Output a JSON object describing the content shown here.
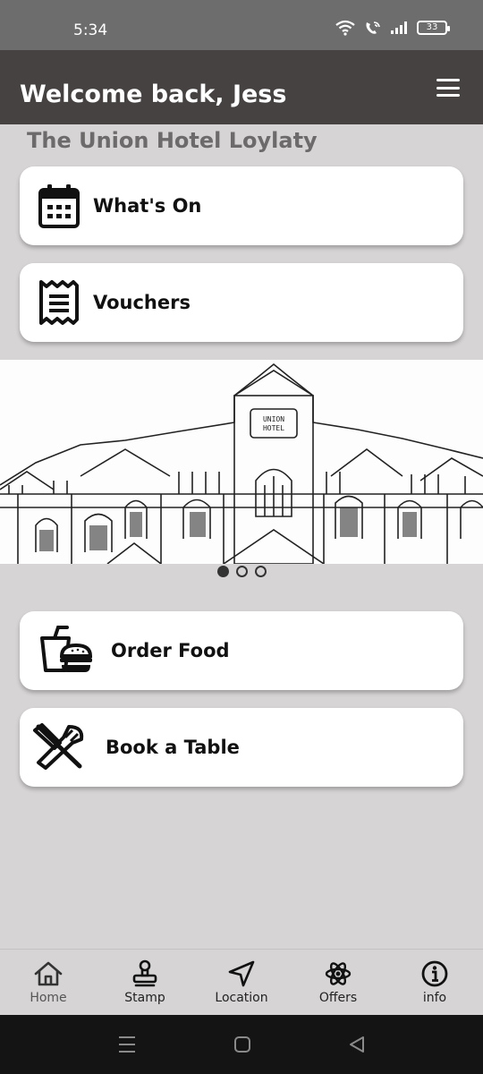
{
  "status_bar": {
    "time": "5:34",
    "battery": "33"
  },
  "header": {
    "title": "Welcome back, Jess",
    "menu_icon": "hamburger-menu-icon"
  },
  "subtitle": "The Union Hotel Loylaty",
  "cards_top": [
    {
      "label": "What's On",
      "icon": "calendar-icon"
    },
    {
      "label": "Vouchers",
      "icon": "receipt-icon"
    }
  ],
  "carousel": {
    "image": "union-hotel-sketch",
    "sign_text_line1": "UNION",
    "sign_text_line2": "HOTEL",
    "slide_count": 3,
    "active_index": 0
  },
  "cards_bottom": [
    {
      "label": "Order Food",
      "icon": "drink-burger-icon"
    },
    {
      "label": "Book a Table",
      "icon": "utensils-icon"
    }
  ],
  "bottom_nav": [
    {
      "label": "Home",
      "icon": "home-icon"
    },
    {
      "label": "Stamp",
      "icon": "stamp-icon"
    },
    {
      "label": "Location",
      "icon": "navigation-arrow-icon"
    },
    {
      "label": "Offers",
      "icon": "atom-icon"
    },
    {
      "label": "info",
      "icon": "info-icon"
    }
  ],
  "colors": {
    "header_bg": "#464242",
    "status_bg": "#6d6d6d",
    "page_bg": "#d6d4d4",
    "card_bg": "#ffffff"
  }
}
